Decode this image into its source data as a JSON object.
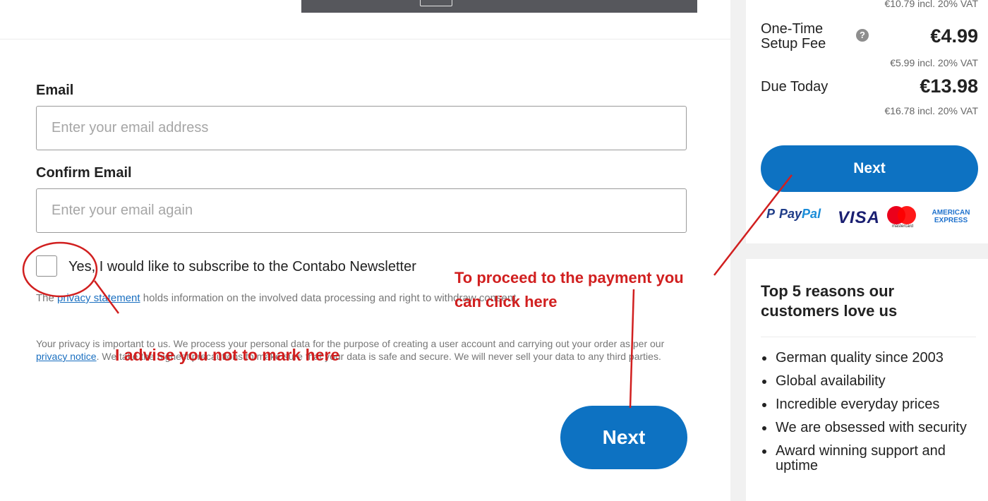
{
  "form": {
    "email_label": "Email",
    "email_placeholder": "Enter your email address",
    "confirm_email_label": "Confirm Email",
    "confirm_email_placeholder": "Enter your email again",
    "newsletter_label": "Yes, I would like to subscribe to the Contabo Newsletter",
    "newsletter_checked": false,
    "consent_prefix": "The ",
    "consent_link": "privacy statement",
    "consent_suffix": " holds information on the involved data processing and right to withdraw consent",
    "privacy_prefix": "Your privacy is important to us. We process your personal data for the purpose of creating a user account and carrying out your order as per our ",
    "privacy_link": "privacy notice",
    "privacy_suffix": ". We take the highest precautions to make sure that your data is safe and secure. We will never sell your data to any third parties.",
    "next_label": "Next"
  },
  "summary": {
    "top_vat": "€10.79 incl. 20% VAT",
    "setup_fee_label": "One-Time Setup Fee",
    "help_icon": "?",
    "setup_fee_price": "€4.99",
    "setup_fee_vat": "€5.99 incl. 20% VAT",
    "due_today_label": "Due Today",
    "due_today_price": "€13.98",
    "due_today_vat": "€16.78 incl. 20% VAT",
    "next_label": "Next"
  },
  "payment_methods": {
    "paypal_a": "Pay",
    "paypal_b": "Pal",
    "visa": "VISA",
    "mastercard": "mastercard",
    "amex_1": "AMERICAN",
    "amex_2": "EXPRESS"
  },
  "reasons": {
    "title": "Top 5 reasons our customers love us",
    "items": [
      "German quality since 2003",
      "Global availability",
      "Incredible everyday prices",
      "We are obsessed with security",
      "Award winning support and uptime"
    ]
  },
  "annotations": {
    "checkbox_note": "I advise you not to mark here",
    "payment_note_line1": "To proceed to the payment you",
    "payment_note_line2": "can click here",
    "color": "#d11f1f"
  },
  "colors": {
    "accent": "#0d72c2",
    "sidebar_bg": "#f1f1f1",
    "annotation_red": "#d11f1f"
  }
}
